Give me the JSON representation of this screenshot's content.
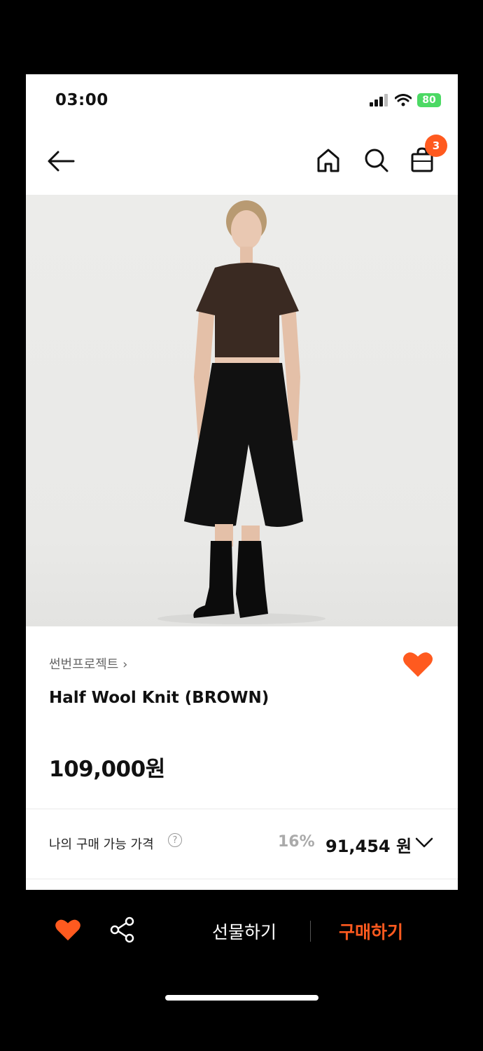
{
  "status_bar": {
    "time": "03:00",
    "battery": "80"
  },
  "header": {
    "cart_count": "3"
  },
  "product": {
    "brand": "썬번프로젝트 ›",
    "name": "Half Wool Knit (BROWN)",
    "price": "109,000원",
    "liked": true
  },
  "my_price": {
    "label": "나의 구매 가능 가격",
    "help": "?",
    "discount": "16%",
    "price": "91,454 원"
  },
  "bottom_bar": {
    "gift_label": "선물하기",
    "buy_label": "구매하기"
  },
  "colors": {
    "accent": "#ff5a1f",
    "text": "#111111",
    "muted": "#666666",
    "image_bg": "#ececea"
  },
  "icons": [
    "back-arrow-icon",
    "home-icon",
    "search-icon",
    "shopping-bag-icon",
    "heart-icon",
    "share-icon",
    "chevron-down-icon"
  ]
}
